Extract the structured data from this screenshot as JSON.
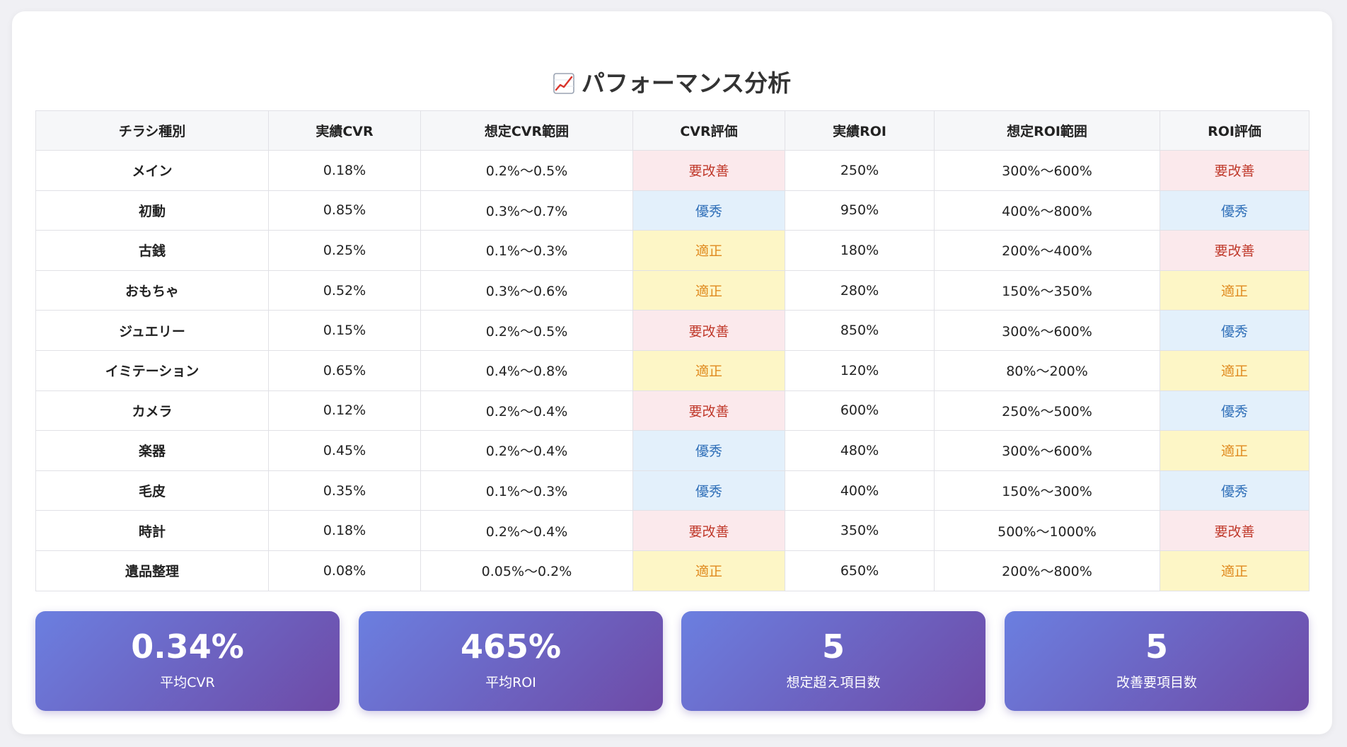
{
  "header": {
    "icon": "chart-increasing-icon",
    "title": "パフォーマンス分析"
  },
  "table": {
    "columns": [
      "チラシ種別",
      "実績CVR",
      "想定CVR範囲",
      "CVR評価",
      "実績ROI",
      "想定ROI範囲",
      "ROI評価"
    ],
    "rows": [
      {
        "name": "メイン",
        "cvr": "0.18%",
        "cvr_range": "0.2%〜0.5%",
        "cvr_eval": "要改善",
        "roi": "250%",
        "roi_range": "300%〜600%",
        "roi_eval": "要改善"
      },
      {
        "name": "初動",
        "cvr": "0.85%",
        "cvr_range": "0.3%〜0.7%",
        "cvr_eval": "優秀",
        "roi": "950%",
        "roi_range": "400%〜800%",
        "roi_eval": "優秀"
      },
      {
        "name": "古銭",
        "cvr": "0.25%",
        "cvr_range": "0.1%〜0.3%",
        "cvr_eval": "適正",
        "roi": "180%",
        "roi_range": "200%〜400%",
        "roi_eval": "要改善"
      },
      {
        "name": "おもちゃ",
        "cvr": "0.52%",
        "cvr_range": "0.3%〜0.6%",
        "cvr_eval": "適正",
        "roi": "280%",
        "roi_range": "150%〜350%",
        "roi_eval": "適正"
      },
      {
        "name": "ジュエリー",
        "cvr": "0.15%",
        "cvr_range": "0.2%〜0.5%",
        "cvr_eval": "要改善",
        "roi": "850%",
        "roi_range": "300%〜600%",
        "roi_eval": "優秀"
      },
      {
        "name": "イミテーション",
        "cvr": "0.65%",
        "cvr_range": "0.4%〜0.8%",
        "cvr_eval": "適正",
        "roi": "120%",
        "roi_range": "80%〜200%",
        "roi_eval": "適正"
      },
      {
        "name": "カメラ",
        "cvr": "0.12%",
        "cvr_range": "0.2%〜0.4%",
        "cvr_eval": "要改善",
        "roi": "600%",
        "roi_range": "250%〜500%",
        "roi_eval": "優秀"
      },
      {
        "name": "楽器",
        "cvr": "0.45%",
        "cvr_range": "0.2%〜0.4%",
        "cvr_eval": "優秀",
        "roi": "480%",
        "roi_range": "300%〜600%",
        "roi_eval": "適正"
      },
      {
        "name": "毛皮",
        "cvr": "0.35%",
        "cvr_range": "0.1%〜0.3%",
        "cvr_eval": "優秀",
        "roi": "400%",
        "roi_range": "150%〜300%",
        "roi_eval": "優秀"
      },
      {
        "name": "時計",
        "cvr": "0.18%",
        "cvr_range": "0.2%〜0.4%",
        "cvr_eval": "要改善",
        "roi": "350%",
        "roi_range": "500%〜1000%",
        "roi_eval": "要改善"
      },
      {
        "name": "遺品整理",
        "cvr": "0.08%",
        "cvr_range": "0.05%〜0.2%",
        "cvr_eval": "適正",
        "roi": "650%",
        "roi_range": "200%〜800%",
        "roi_eval": "適正"
      }
    ]
  },
  "evaluation_colors": {
    "要改善": {
      "bg": "#fbe9ec",
      "fg": "#c0392b"
    },
    "適正": {
      "bg": "#fdf6c6",
      "fg": "#e08a1e"
    },
    "優秀": {
      "bg": "#e3f0fb",
      "fg": "#2f6fb8"
    }
  },
  "stats": [
    {
      "value": "0.34%",
      "label": "平均CVR"
    },
    {
      "value": "465%",
      "label": "平均ROI"
    },
    {
      "value": "5",
      "label": "想定超え項目数"
    },
    {
      "value": "5",
      "label": "改善要項目数"
    }
  ],
  "colors": {
    "stat_gradient_start": "#6b7fe0",
    "stat_gradient_end": "#6e4aa6"
  }
}
